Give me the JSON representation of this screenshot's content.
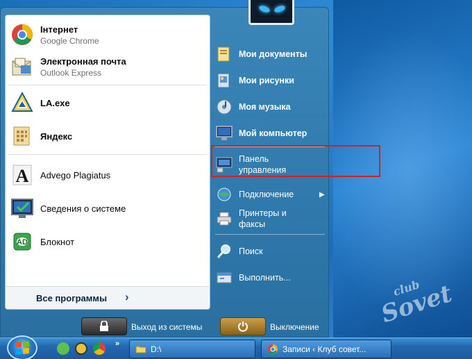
{
  "start_menu": {
    "pinned": [
      {
        "title": "Інтернет",
        "subtitle": "Google Chrome",
        "icon": "chrome-icon"
      },
      {
        "title": "Электронная почта",
        "subtitle": "Outlook Express",
        "icon": "outlook-express-icon"
      }
    ],
    "recent": [
      {
        "title": "LA.exe",
        "icon": "la-exe-icon"
      },
      {
        "title": "Яндекс",
        "icon": "yandex-icon"
      },
      {
        "title": "Advego Plagiatus",
        "icon": "advego-icon"
      },
      {
        "title": "Сведения о системе",
        "icon": "system-info-icon"
      },
      {
        "title": "Блокнот",
        "icon": "notepad-icon"
      }
    ],
    "all_programs_label": "Все программы",
    "right_items": [
      {
        "label": "Мои документы",
        "icon": "my-documents-icon"
      },
      {
        "label": "Мои рисунки",
        "icon": "my-pictures-icon"
      },
      {
        "label": "Моя музыка",
        "icon": "my-music-icon"
      },
      {
        "label": "Мой компьютер",
        "icon": "my-computer-icon"
      },
      {
        "label": "Панель\nуправления",
        "icon": "control-panel-icon"
      },
      {
        "label": "Подключение",
        "icon": "connection-icon"
      },
      {
        "label": "Принтеры и\nфаксы",
        "icon": "printers-icon"
      },
      {
        "label": "Поиск",
        "icon": "search-icon"
      },
      {
        "label": "Выполнить...",
        "icon": "run-icon"
      }
    ],
    "logoff_label": "Выход из системы",
    "shutdown_label": "Выключение"
  },
  "taskbar": {
    "quick_launch_more": "»",
    "tasks": [
      {
        "label": "D:\\",
        "icon": "folder-icon"
      },
      {
        "label": "Записи ‹ Клуб совет...",
        "icon": "chrome-icon"
      }
    ]
  },
  "watermark": {
    "top": "club",
    "main": "Sovet"
  },
  "colors": {
    "menu_blue": "#3b86b8",
    "highlight_red": "#d62020",
    "taskbar_blue": "#2467ad"
  }
}
